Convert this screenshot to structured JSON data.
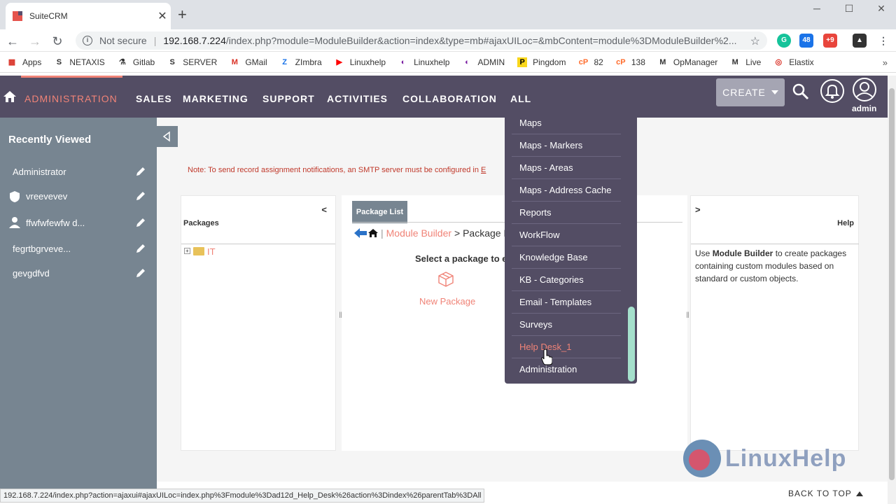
{
  "browser": {
    "tab_title": "SuiteCRM",
    "new_tab_symbol": "+",
    "not_secure": "Not secure",
    "url_host": "192.168.7.224",
    "url_path": "/index.php?module=ModuleBuilder&action=index&type=mb#ajaxUILoc=&mbContent=module%3DModuleBuilder%2...",
    "ext_badges": [
      "48",
      "+9"
    ]
  },
  "bookmarks": [
    {
      "label": "Apps",
      "icon": "apps-grid-icon",
      "color": "#d93025"
    },
    {
      "label": "NETAXIS",
      "icon": "s-icon",
      "color": "#333"
    },
    {
      "label": "Gitlab",
      "icon": "gitlab-icon",
      "color": "#333"
    },
    {
      "label": "SERVER",
      "icon": "s-icon",
      "color": "#333"
    },
    {
      "label": "GMail",
      "icon": "gmail-icon",
      "color": "#d93025"
    },
    {
      "label": "ZImbra",
      "icon": "zimbra-icon",
      "color": "#1a73e8"
    },
    {
      "label": "Linuxhelp",
      "icon": "youtube-icon",
      "color": "#ff0000"
    },
    {
      "label": "Linuxhelp",
      "icon": "linuxhelp-icon",
      "color": "#7b1fa2"
    },
    {
      "label": "ADMIN",
      "icon": "linuxhelp-icon",
      "color": "#7b1fa2"
    },
    {
      "label": "Pingdom",
      "icon": "pingdom-icon",
      "color": "#f9d71c"
    },
    {
      "label": "82",
      "icon": "cpanel-icon",
      "color": "#ff6c2c"
    },
    {
      "label": "138",
      "icon": "cpanel-icon",
      "color": "#ff6c2c"
    },
    {
      "label": "OpManager",
      "icon": "opmanager-icon",
      "color": "#333"
    },
    {
      "label": "Live",
      "icon": "live-icon",
      "color": "#333"
    },
    {
      "label": "Elastix",
      "icon": "elastix-icon",
      "color": "#d93025"
    }
  ],
  "nav": {
    "items": [
      "ADMINISTRATION",
      "SALES",
      "MARKETING",
      "SUPPORT",
      "ACTIVITIES",
      "COLLABORATION",
      "ALL"
    ],
    "create_label": "CREATE",
    "username": "admin"
  },
  "sidebar": {
    "title": "Recently Viewed",
    "items": [
      {
        "label": "Administrator",
        "icon": ""
      },
      {
        "label": "vreevevev",
        "icon": "shield-icon"
      },
      {
        "label": "ffwfwfewfw d...",
        "icon": "person-icon"
      },
      {
        "label": "fegrtbgrveve...",
        "icon": ""
      },
      {
        "label": "gevgdfvd",
        "icon": ""
      }
    ]
  },
  "main": {
    "notice": "Note: To send record assignment notifications, an SMTP server must be configured in",
    "notice_link": "E",
    "packages": {
      "collapse": "<",
      "title": "Packages",
      "tree": [
        {
          "label": "IT"
        }
      ]
    },
    "package_list": {
      "tab": "Package List",
      "breadcrumb_link": "Module Builder",
      "breadcrumb_rest": "> Package Li",
      "select_text": "Select a package to ed",
      "new_package": "New Package"
    },
    "help": {
      "collapse": ">",
      "title": "Help",
      "body_pre": "Use",
      "body_bold": "Module Builder",
      "body_post": "to create packages containing custom modules based on standard or custom objects."
    }
  },
  "dropdown": {
    "items": [
      "Maps",
      "Maps - Markers",
      "Maps - Areas",
      "Maps - Address Cache",
      "Reports",
      "WorkFlow",
      "Knowledge Base",
      "KB - Categories",
      "Email - Templates",
      "Surveys",
      "Help Desk_1",
      "Administration"
    ],
    "hovered_index": 10
  },
  "footer": {
    "status_url": "192.168.7.224/index.php?action=ajaxui#ajaxUILoc=index.php%3Fmodule%3Dad12d_Help_Desk%26action%3Dindex%26parentTab%3DAll",
    "back_to_top": "BACK TO TOP",
    "watermark": "LinuxHelp"
  },
  "colors": {
    "nav_bg": "#534d64",
    "accent": "#f08377",
    "sidebar_bg": "#778591"
  }
}
